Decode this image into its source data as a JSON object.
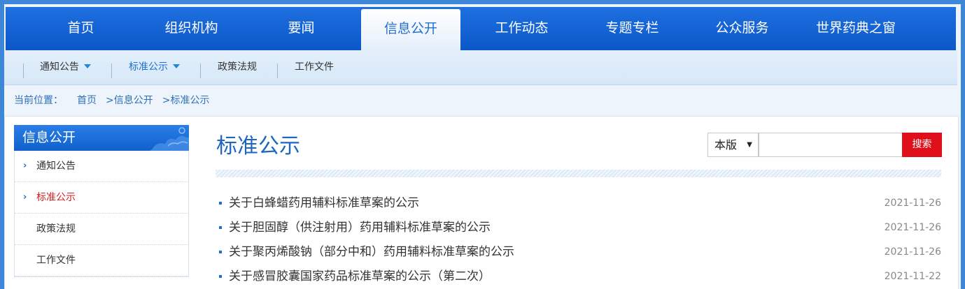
{
  "nav": {
    "items": [
      "首页",
      "组织机构",
      "要闻",
      "信息公开",
      "工作动态",
      "专题专栏",
      "公众服务",
      "世界药典之窗"
    ],
    "active": "信息公开"
  },
  "subnav": {
    "items": [
      "通知公告",
      "标准公示",
      "政策法规",
      "工作文件"
    ]
  },
  "breadcrumb": {
    "label": "当前位置：",
    "items": [
      "首页",
      "信息公开",
      "标准公示"
    ],
    "separator": ">"
  },
  "sidebar": {
    "title": "信息公开",
    "items": [
      "通知公告",
      "标准公示",
      "政策法规",
      "工作文件"
    ]
  },
  "content": {
    "title": "标准公示",
    "search": {
      "scope": "本版",
      "button": "搜索",
      "value": ""
    },
    "news": [
      {
        "title": "关于白蜂蜡药用辅料标准草案的公示",
        "date": "2021-11-26"
      },
      {
        "title": "关于胆固醇（供注射用）药用辅料标准草案的公示",
        "date": "2021-11-26"
      },
      {
        "title": "关于聚丙烯酸钠（部分中和）药用辅料标准草案的公示",
        "date": "2021-11-26"
      },
      {
        "title": "关于感冒胶囊国家药品标准草案的公示（第二次）",
        "date": "2021-11-22"
      }
    ]
  },
  "colors": {
    "nav_blue": "#0b58c9",
    "accent_blue": "#1f6fd0",
    "active_red": "#d41e1e",
    "search_red": "#e0101a"
  }
}
